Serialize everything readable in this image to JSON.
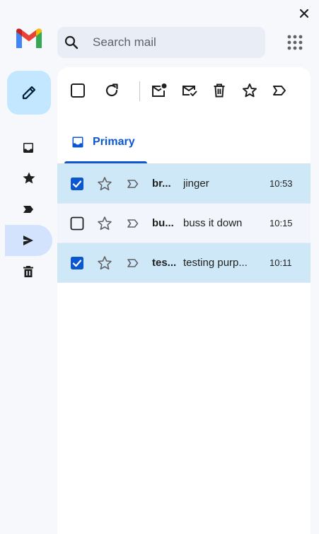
{
  "search": {
    "placeholder": "Search mail"
  },
  "tabs": [
    {
      "label": "Primary"
    }
  ],
  "emails": [
    {
      "sender": "br...",
      "subject": "jinger",
      "time": "10:53",
      "selected": true
    },
    {
      "sender": "bu...",
      "subject": "buss it down",
      "time": "10:15",
      "selected": false
    },
    {
      "sender": "tes...",
      "subject": "testing purp...",
      "time": "10:11",
      "selected": true
    }
  ],
  "sidebar": {
    "items": [
      {
        "icon": "inbox-icon",
        "active": false
      },
      {
        "icon": "star-icon",
        "active": false
      },
      {
        "icon": "label-icon",
        "active": false
      },
      {
        "icon": "send-icon",
        "active": true
      },
      {
        "icon": "trash-icon",
        "active": false
      }
    ]
  },
  "toolbar": {
    "icons": [
      "select-all-checkbox",
      "refresh-icon",
      "mark-unread-icon",
      "mark-read-icon",
      "delete-icon",
      "star-icon",
      "label-icon"
    ]
  },
  "colors": {
    "accent": "#0b57d0",
    "compose_bg": "#c2e7ff",
    "selected_row": "#cfe8f7",
    "active_nav": "#d3e3fd",
    "search_bg": "#e9eef6"
  }
}
